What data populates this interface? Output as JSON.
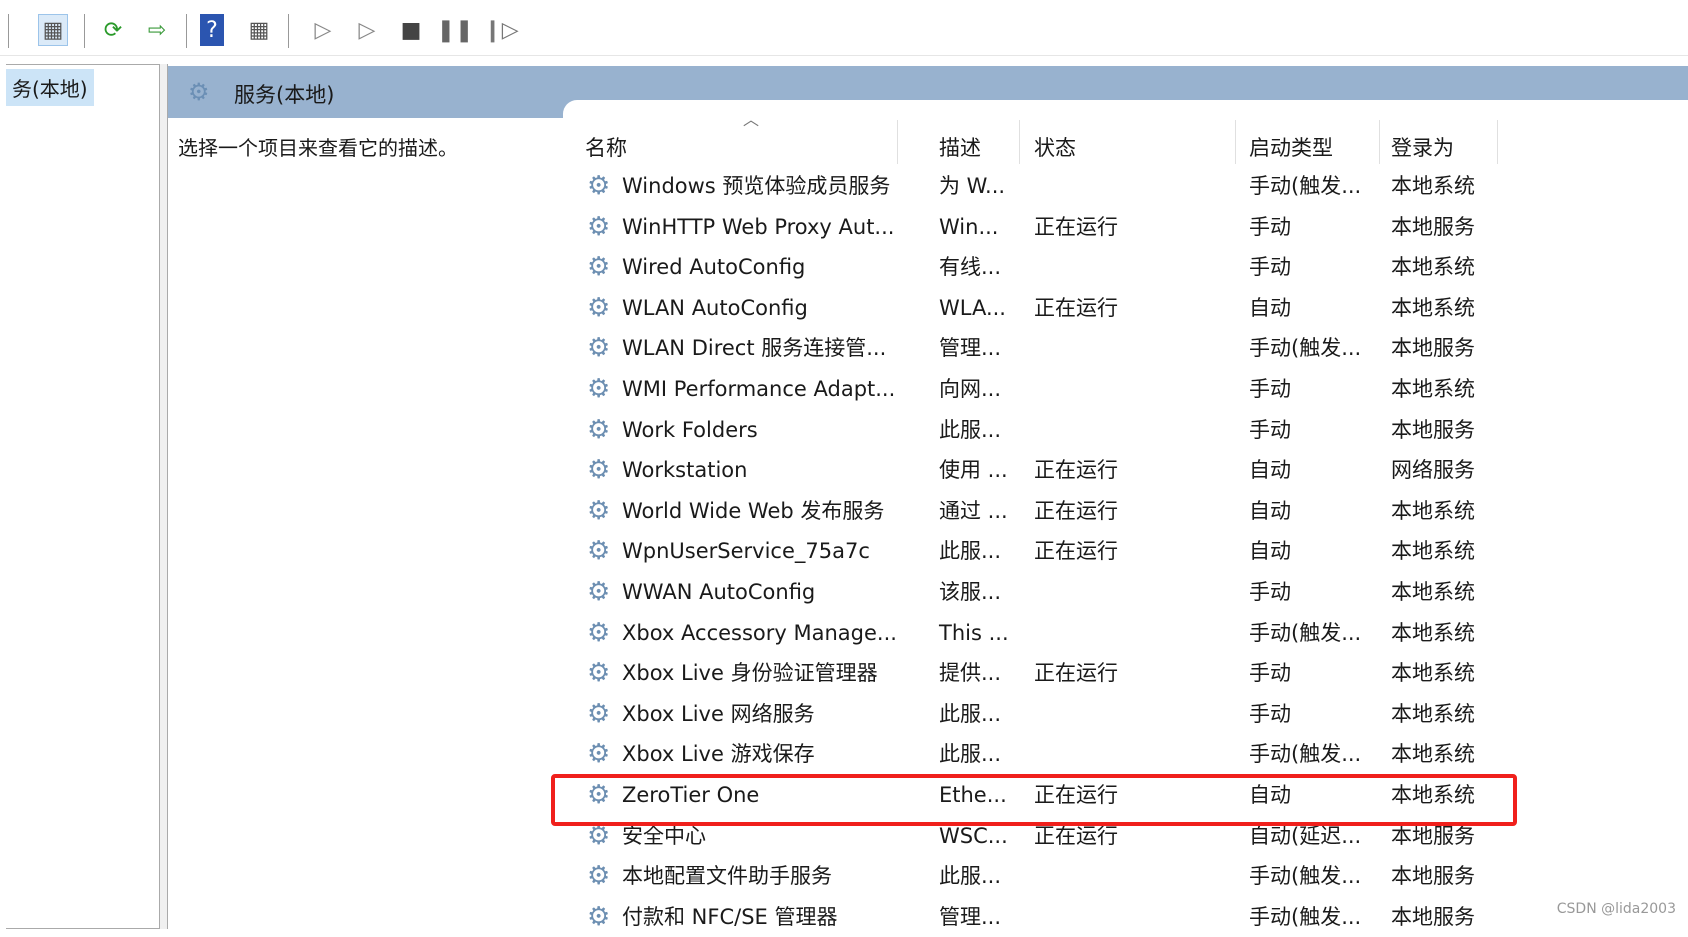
{
  "toolbar": {
    "buttons": [
      "show-hide-console-tree",
      "refresh",
      "export-list",
      "help",
      "show-hide-action-pane",
      "start",
      "start-alt",
      "stop",
      "pause",
      "resume"
    ]
  },
  "tree": {
    "selected": "务(本地)"
  },
  "header": {
    "title": "服务(本地)"
  },
  "description": "选择一个项目来查看它的描述。",
  "columns": [
    "名称",
    "描述",
    "状态",
    "启动类型",
    "登录为"
  ],
  "rows": [
    [
      "Windows 预览体验成员服务",
      "为 W...",
      "",
      "手动(触发...",
      "本地系统"
    ],
    [
      "WinHTTP Web Proxy Aut...",
      "Win...",
      "正在运行",
      "手动",
      "本地服务"
    ],
    [
      "Wired AutoConfig",
      "有线...",
      "",
      "手动",
      "本地系统"
    ],
    [
      "WLAN AutoConfig",
      "WLA...",
      "正在运行",
      "自动",
      "本地系统"
    ],
    [
      "WLAN Direct 服务连接管...",
      "管理...",
      "",
      "手动(触发...",
      "本地服务"
    ],
    [
      "WMI Performance Adapt...",
      "向网...",
      "",
      "手动",
      "本地系统"
    ],
    [
      "Work Folders",
      "此服...",
      "",
      "手动",
      "本地服务"
    ],
    [
      "Workstation",
      "使用 ...",
      "正在运行",
      "自动",
      "网络服务"
    ],
    [
      "World Wide Web 发布服务",
      "通过 ...",
      "正在运行",
      "自动",
      "本地系统"
    ],
    [
      "WpnUserService_75a7c",
      "此服...",
      "正在运行",
      "自动",
      "本地系统"
    ],
    [
      "WWAN AutoConfig",
      "该服...",
      "",
      "手动",
      "本地系统"
    ],
    [
      "Xbox Accessory Manage...",
      "This ...",
      "",
      "手动(触发...",
      "本地系统"
    ],
    [
      "Xbox Live 身份验证管理器",
      "提供...",
      "正在运行",
      "手动",
      "本地系统"
    ],
    [
      "Xbox Live 网络服务",
      "此服...",
      "",
      "手动",
      "本地系统"
    ],
    [
      "Xbox Live 游戏保存",
      "此服...",
      "",
      "手动(触发...",
      "本地系统"
    ],
    [
      "ZeroTier One",
      "Ethe...",
      "正在运行",
      "自动",
      "本地系统"
    ],
    [
      "安全中心",
      "WSC...",
      "正在运行",
      "自动(延迟...",
      "本地服务"
    ],
    [
      "本地配置文件助手服务",
      "此服...",
      "",
      "手动(触发...",
      "本地服务"
    ],
    [
      "付款和 NFC/SE 管理器",
      "管理...",
      "",
      "手动(触发...",
      "本地服务"
    ]
  ],
  "highlight_color": "#f0201c",
  "watermark": "CSDN @lida2003"
}
